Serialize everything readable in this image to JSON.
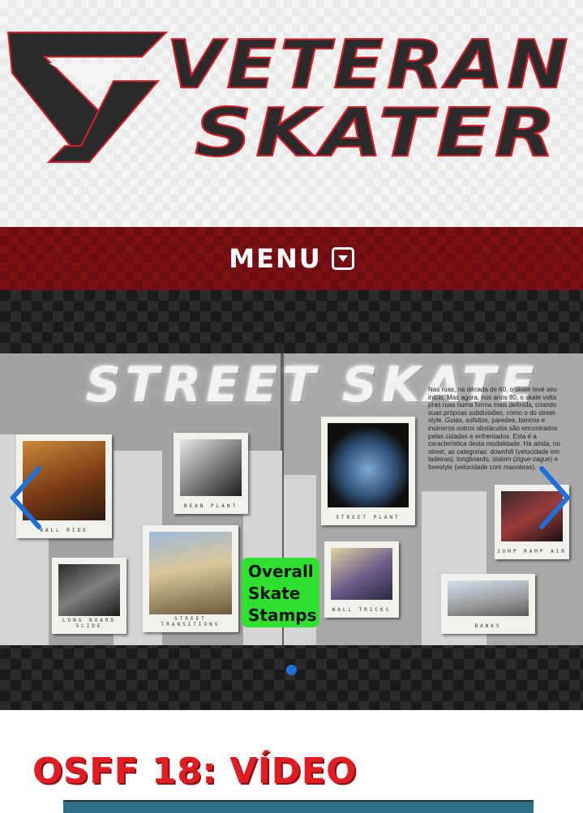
{
  "site": {
    "logo_line1": "VETERAN",
    "logo_line2": "SKATER"
  },
  "menu": {
    "label": "MENU"
  },
  "slider": {
    "slide_title": "STREET SKATE",
    "badge": {
      "line1": "Overall",
      "line2": "Skate",
      "line3": "Stamps"
    },
    "photo_captions": [
      "WALL RIDE",
      "BEAN PLANT",
      "STREET PLANT",
      "JUMP RAMP AIR",
      "STREET TRANSITIONS",
      "LONG BOARD SLIDE",
      "WALL TRICKS",
      "BANKS"
    ],
    "article_text": "Nas ruas, na década de 60, o skate teve seu início. Mas agora, nos anos 80, o skate volta pras ruas numa forma mais definida, criando suas próprias subdivisões, como o do street-style. Guias, asfaltos, paredes, bancos e inúmeros outros obstáculos são encontrados pelas cidades e enfrentados. Esta é a característica desta modalidade. Há ainda, no street, as categorias: downhill (velocidade em ladeiras), longboards, slalom (zigue-zague) e freestyle (velocidade com manobras).",
    "active_dot": 1,
    "dot_color": "#1e6fd9",
    "arrow_color": "#1e6fd9"
  },
  "article": {
    "heading": "OSFF 18: VÍDEO"
  },
  "colors": {
    "brand_red": "#e11d24",
    "menu_bg": "#7c1015",
    "badge_green": "#2ee12e"
  }
}
